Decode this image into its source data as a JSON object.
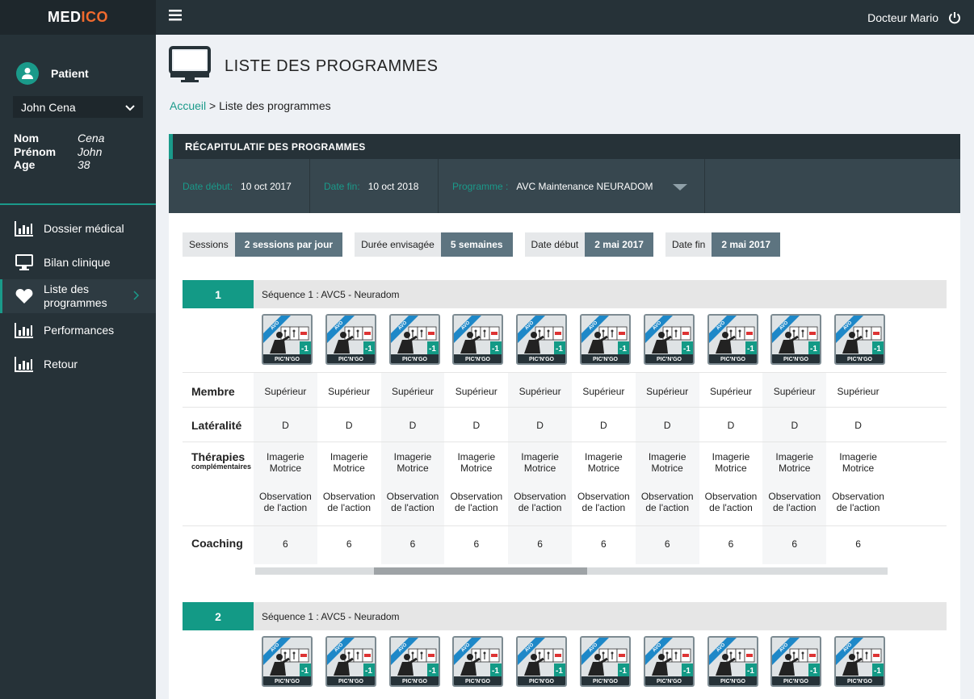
{
  "brand": {
    "part1": "MED",
    "part2": "ICO"
  },
  "sidebar": {
    "patient_label": "Patient",
    "patient_selected": "John Cena",
    "info": [
      {
        "key": "Nom",
        "value": "Cena"
      },
      {
        "key": "Prénom",
        "value": "John"
      },
      {
        "key": "Age",
        "value": "38"
      }
    ],
    "nav": [
      {
        "label": "Dossier médical",
        "icon": "bar-chart-icon"
      },
      {
        "label": "Bilan clinique",
        "icon": "monitor-icon"
      },
      {
        "label": "Liste des programmes",
        "icon": "heart-icon",
        "active": true
      },
      {
        "label": "Performances",
        "icon": "bar-chart-icon"
      },
      {
        "label": "Retour",
        "icon": "bar-chart-icon"
      }
    ]
  },
  "topbar": {
    "user": "Docteur Mario",
    "menu_icon": "hamburger-icon",
    "power_icon": "power-icon"
  },
  "page": {
    "title": "LISTE DES PROGRAMMES"
  },
  "breadcrumb": {
    "home": "Accueil",
    "separator": ">",
    "current": "Liste des programmes"
  },
  "summary": {
    "title_first": "R",
    "title_rest": "ÉCAPITULATIF DES PROGRAMMES",
    "date_start_label": "Date début:",
    "date_start_value": "10 oct 2017",
    "date_end_label": "Date fin:",
    "date_end_value": "10 oct 2018",
    "program_label": "Programme :",
    "program_value": "AVC Maintenance NEURADOM"
  },
  "chips": [
    {
      "label": "Sessions",
      "value": "2 sessions par jour"
    },
    {
      "label": "Durée envisagée",
      "value": "5 semaines"
    },
    {
      "label": "Date début",
      "value": "2 mai 2017"
    },
    {
      "label": "Date fin",
      "value": "2 mai 2017"
    }
  ],
  "card": {
    "tag": "AVO",
    "badge": "-1",
    "caption": "PIC'N'GO"
  },
  "row_labels": {
    "membre": "Membre",
    "lateralite": "Latéralité",
    "therapies": "Thérapies",
    "therapies_sub": "complémentaires",
    "coaching": "Coaching"
  },
  "sequences": [
    {
      "number": "1",
      "title": "Séquence 1 : AVC5 - Neuradom",
      "membre": "Supérieur",
      "lateralite": "D",
      "therapy1_a": "Imagerie",
      "therapy1_b": "Motrice",
      "therapy2_a": "Observation",
      "therapy2_b": "de l'action",
      "coaching": "6"
    },
    {
      "number": "2",
      "title": "Séquence 1 : AVC5 - Neuradom"
    }
  ],
  "colors": {
    "accent": "#1a9a8a",
    "dark": "#263238",
    "logo_orange": "#f26b2e"
  }
}
